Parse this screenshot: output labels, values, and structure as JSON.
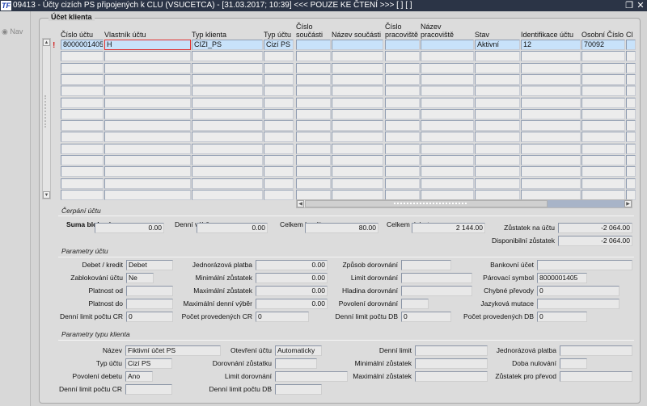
{
  "window": {
    "title": "09413 - Účty cizích PS připojených k CLU (VSUCETCA) - [31.03.2017; 10:39] <<< POUZE KE ČTENÍ >>>  [ ]  [ ]",
    "logo": "TF",
    "restore_icon": "restore-icon",
    "close_icon": "close-icon"
  },
  "nav": {
    "label": "Nav"
  },
  "grid": {
    "title": "Účet klienta",
    "columns": [
      "Číslo účtu",
      "Vlastník účtu",
      "Typ klienta",
      "Typ účtu",
      "Číslo součásti",
      "Název součásti",
      "Číslo pracoviště",
      "Název pracoviště",
      "Stav",
      "Identifikace účtu",
      "Osobní Číslo",
      "Cl"
    ],
    "row_marker": "!",
    "rows": [
      [
        "8000001405",
        "H",
        "CIZI_PS",
        "Cizí PS",
        "",
        "",
        "",
        "",
        "Aktivní",
        "12",
        "70092",
        ""
      ]
    ],
    "visible_rows": 14,
    "selection_color": "#c8e2fa",
    "current_cell_border": "#e03030"
  },
  "cerpani": {
    "title": "Čerpání účtu",
    "suma_blokaci": {
      "label": "Suma blokací",
      "value": "0.00"
    },
    "denni_vyber": {
      "label": "Denní výběr",
      "value": "0.00"
    },
    "celkem_kredit": {
      "label": "Celkem kredit",
      "value": "80.00"
    },
    "celkem_debet": {
      "label": "Celkem debet",
      "value": "2 144.00"
    },
    "zustatek": {
      "label": "Zůstatek na účtu",
      "value": "-2 064.00"
    },
    "disponibilni": {
      "label": "Disponibilní zůstatek",
      "value": "-2 064.00"
    }
  },
  "parametry_uctu": {
    "title": "Parametry účtu",
    "fields": [
      {
        "label": "Debet / kredit",
        "value": "Debet"
      },
      {
        "label": "Zablokování účtu",
        "value": "Ne"
      },
      {
        "label": "Platnost od",
        "value": ""
      },
      {
        "label": "Platnost do",
        "value": ""
      },
      {
        "label": "Denní limit počtu CR",
        "value": "0"
      },
      {
        "label": "Jednorázová platba",
        "value": "0.00"
      },
      {
        "label": "Minimální zůstatek",
        "value": "0.00"
      },
      {
        "label": "Maximální zůstatek",
        "value": "0.00"
      },
      {
        "label": "Maximální denní výběr",
        "value": "0.00"
      },
      {
        "label": "Počet provedených CR",
        "value": "0"
      },
      {
        "label": "Způsob dorovnání",
        "value": ""
      },
      {
        "label": "Limit dorovnání",
        "value": ""
      },
      {
        "label": "Hladina dorovnání",
        "value": ""
      },
      {
        "label": "Povolení dorovnání",
        "value": ""
      },
      {
        "label": "Denní limit počtu DB",
        "value": "0"
      },
      {
        "label": "Bankovní účet",
        "value": ""
      },
      {
        "label": "Párovací symbol",
        "value": "8000001405"
      },
      {
        "label": "Chybné převody",
        "value": "0"
      },
      {
        "label": "Jazyková mutace",
        "value": ""
      },
      {
        "label": "Počet provedených DB",
        "value": "0"
      }
    ]
  },
  "parametry_typu": {
    "title": "Parametry typu klienta",
    "fields": [
      {
        "label": "Název",
        "value": "Fiktivní účet  PS"
      },
      {
        "label": "Typ účtu",
        "value": "Cizí PS"
      },
      {
        "label": "Povolení debetu",
        "value": "Ano"
      },
      {
        "label": "Denní limit počtu CR",
        "value": ""
      },
      {
        "label": "Otevření účtu",
        "value": "Automaticky"
      },
      {
        "label": "Dorovnání zůstatku",
        "value": ""
      },
      {
        "label": "Limit dorovnání",
        "value": ""
      },
      {
        "label": "Denní limit počtu DB",
        "value": ""
      },
      {
        "label": "Denní limit",
        "value": ""
      },
      {
        "label": "Minimální zůstatek",
        "value": ""
      },
      {
        "label": "Maximální zůstatek",
        "value": ""
      },
      {
        "label": "Jednorázová platba",
        "value": ""
      },
      {
        "label": "Doba nulování",
        "value": ""
      },
      {
        "label": "Zůstatek pro převod",
        "value": ""
      }
    ]
  }
}
